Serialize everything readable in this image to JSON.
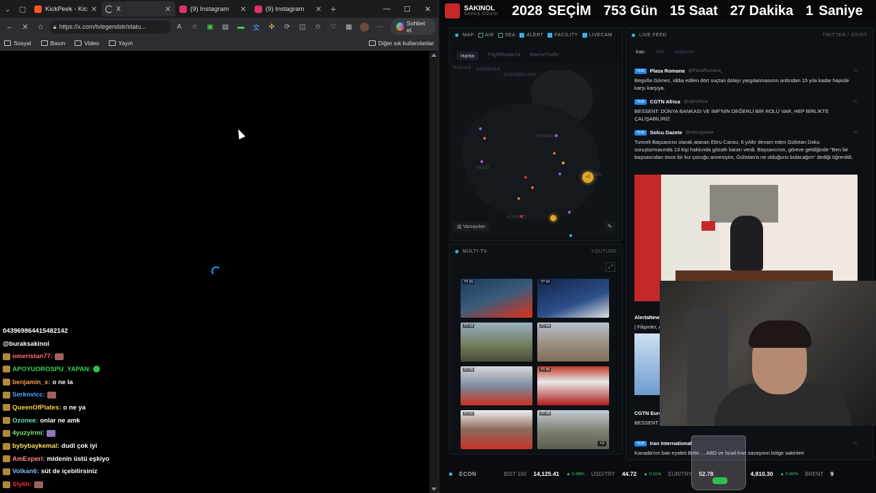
{
  "browser": {
    "tabs": [
      {
        "label": "KickPeek - Kick",
        "color": "#ff5722"
      },
      {
        "label": "X",
        "color": "#ffffff"
      },
      {
        "label": "(9) Instagram",
        "color": "#e1306c"
      },
      {
        "label": "(9) Instagram",
        "color": "#e1306c"
      }
    ],
    "url": "https://x.com/tvlegendstr/statu...",
    "copilot_label": "Sohbet et",
    "bookmarks": [
      "Sosyal",
      "Basın",
      "Video",
      "Yayın"
    ],
    "bookmarks_other": "Diğer sık kullanılanlar"
  },
  "chat": {
    "top_lines": [
      "043969864415482142",
      "@buraksakinol"
    ],
    "messages": [
      {
        "user": "omeristan77:",
        "text": "",
        "color": "#ff6b6b",
        "emote": "red"
      },
      {
        "user": "APOYUOROSPU_YAPAN:",
        "text": "",
        "color": "#39d353",
        "emote": "green"
      },
      {
        "user": "benjamin_x:",
        "text": "o ne la",
        "color": "#ff9f43",
        "emote": ""
      },
      {
        "user": "Serkovicc:",
        "text": "",
        "color": "#4fa3ff",
        "emote": "red"
      },
      {
        "user": "QueenOfPlates:",
        "text": "o ne ya",
        "color": "#ffd43b",
        "emote": ""
      },
      {
        "user": "Ozonee:",
        "text": "onlar ne amk",
        "color": "#63e6be",
        "emote": ""
      },
      {
        "user": "4yuzyirmi:",
        "text": "",
        "color": "#7be37b",
        "emote": "purple"
      },
      {
        "user": "bybybaykemal:",
        "text": "dudi çok iyi",
        "color": "#ffe066",
        "emote": ""
      },
      {
        "user": "AmExperi:",
        "text": "midenin üstü eşkiyo",
        "color": "#ff8787",
        "emote": ""
      },
      {
        "user": "Volkan6:",
        "text": "süt de içebilirsiniz",
        "color": "#74c0fc",
        "emote": ""
      },
      {
        "user": "Sly6h:",
        "text": "",
        "color": "#e03131",
        "emote": "red"
      }
    ]
  },
  "dashboard": {
    "brand": "SAKINOL",
    "brand_sub": "SAVAŞ ODASI",
    "countdown": [
      "2028",
      "SEÇİM",
      "753 Gün",
      "15 Saat",
      "27 Dakika",
      "1",
      "Saniye"
    ],
    "map": {
      "title": "MAP",
      "filters": [
        {
          "label": "AIR",
          "on": false
        },
        {
          "label": "SEA",
          "on": false
        },
        {
          "label": "ALERT",
          "on": true
        },
        {
          "label": "FACILITY",
          "on": true
        },
        {
          "label": "LIVECAM",
          "on": true
        }
      ],
      "tabs": [
        "Harita",
        "FlightRadar24",
        "MarineTraffic"
      ],
      "radar_label": "RADAR",
      "labels": [
        "ARMENIA",
        "AZERBAIJAN",
        "TEHRAN",
        "IRAQ",
        "IRAN",
        "KUWAIT"
      ],
      "cluster": "+2",
      "preset_button": "Varsayılan"
    },
    "multitv": {
      "title": "MULTI-TV",
      "right": "YOUTUBE",
      "channels": [
        "YT #1",
        "YT #2",
        "YT #3",
        "YT #4",
        "YT #5",
        "YT #6",
        "YT #7",
        "YT #8"
      ],
      "more": "+2"
    },
    "livefeed": {
      "title": "LIVE FEED",
      "right": "TWITTER / OSINT",
      "tabs": [
        "İran",
        "İBB",
        "Haberler"
      ],
      "new_label": "YENİ",
      "items": [
        {
          "source": "Plaza Romana",
          "handle": "@PlazaRomana_",
          "age": "2s",
          "text": "Begoña Gómez, iddia edilen dört suçtan dolayı yargılanmasının ardından 15 yıla kadar hapisle karşı karşıya."
        },
        {
          "source": "CGTN Africa",
          "handle": "@cgtnafrica",
          "age": "4s",
          "text": "BESSENT: DÜNYA BANKASI VE IMF'NİN DEĞERLİ BİR ROLÜ VAR, HEP BİRLİKTE ÇALIŞABİLİRİZ"
        },
        {
          "source": "Solcu Gazete",
          "handle": "@solcugazete",
          "age": "4s",
          "text": "Tunceli Başsavcısı olarak atanan Ebru Cansu, 6 yıldır devam eden Gülistan Doku soruşturmasında 13 kişi hakkında gözaltı kararı verdi. Başsavcının, göreve geldiğinde \"Ben bir başsavcıdan önce bir kız çocuğu annesiyim, Gülistan'a ne olduğunu bulacağım\" dediği öğrenildi."
        }
      ],
      "partial": [
        "AlertaNews",
        "| Filipinler, A",
        "CGTN Europ",
        "BESSENT: DÜ"
      ],
      "last": {
        "source": "Iran International",
        "age": "5s",
        "text": "Kanada'nın batı eyaleti Britis ... ABD ve İsrail-İran savaşının bölge sakinleri"
      }
    },
    "econ": {
      "title": "ECON",
      "items": [
        {
          "label": "BIST 100",
          "value": "14,125.41",
          "change": "▲ 0.48%"
        },
        {
          "label": "USD/TRY",
          "value": "44.72",
          "change": "▲ 0.11%"
        },
        {
          "label": "EUR/TRY",
          "value": "52.78",
          "change": ""
        },
        {
          "label": "",
          "value": "4,810.30",
          "change": "▲ 0.90%"
        },
        {
          "label": "BRENT",
          "value": "9",
          "change": ""
        }
      ]
    }
  }
}
